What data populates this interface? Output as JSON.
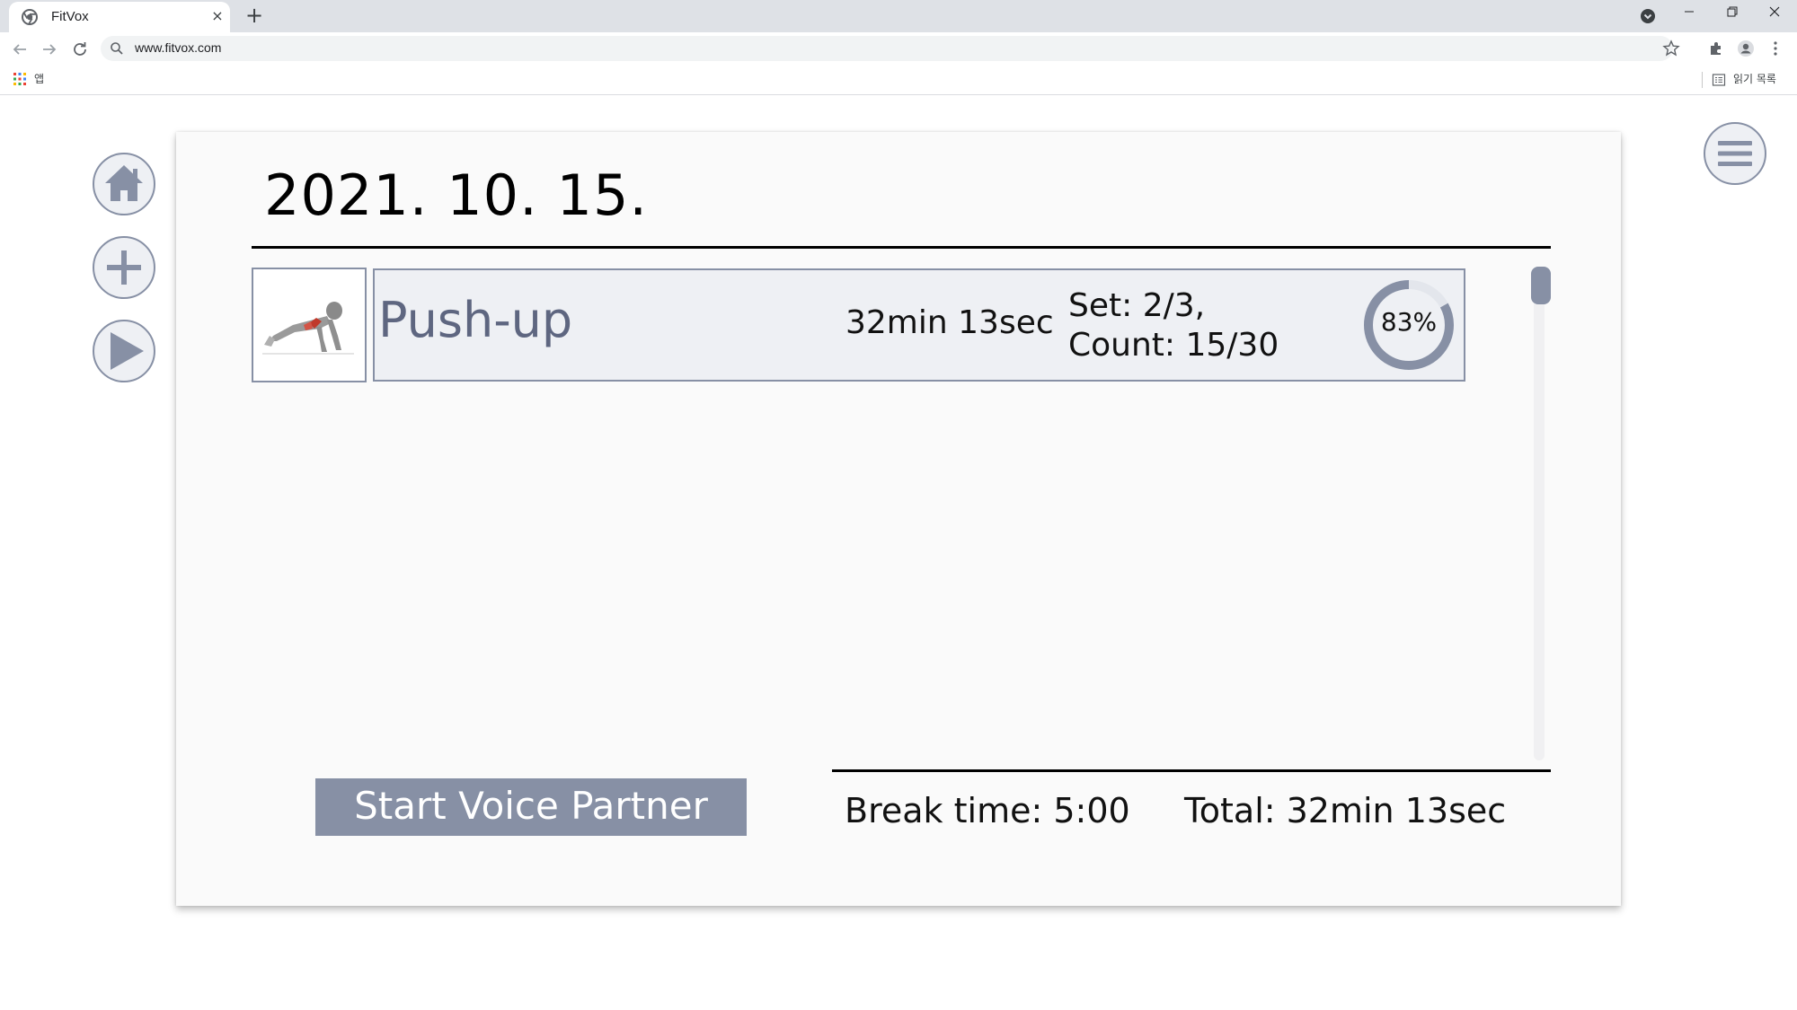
{
  "browser": {
    "tab_title": "FitVox",
    "tab_close": "×",
    "new_tab": "+",
    "url": "www.fitvox.com",
    "bookmarks_apps_label": "앱",
    "reading_list_label": "읽기 목록"
  },
  "sidebar": {
    "buttons": [
      "home-icon",
      "plus-icon",
      "play-icon"
    ]
  },
  "workout": {
    "date": "2021. 10. 15.",
    "exercises": [
      {
        "name": "Push-up",
        "duration": "32min 13sec",
        "set_line": "Set: 2/3,",
        "count_line": "Count: 15/30",
        "progress_label": "83%",
        "progress": 0.83
      }
    ],
    "start_button": "Start Voice Partner",
    "break_time": "Break time: 5:00",
    "total": "Total: 32min 13sec"
  },
  "colors": {
    "accent": "#8790a5",
    "row_bg": "#eef0f4",
    "card_bg": "#fafafa"
  }
}
